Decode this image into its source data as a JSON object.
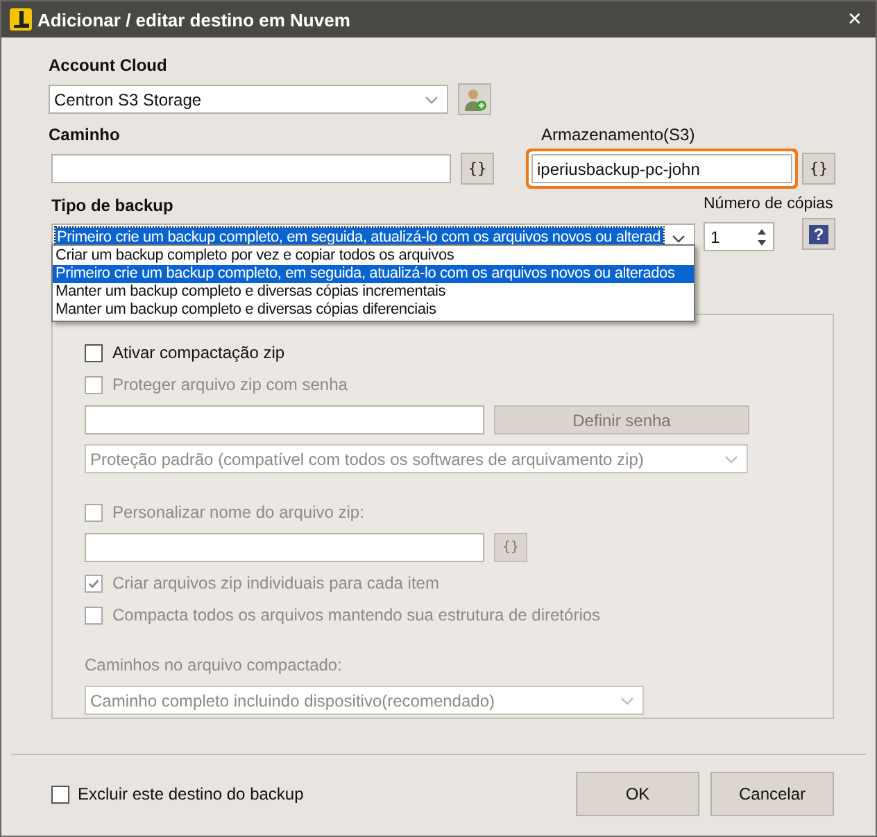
{
  "window": {
    "title": "Adicionar / editar destino em Nuvem",
    "close": "✕"
  },
  "account_cloud": {
    "label": "Account Cloud",
    "value": "Centron S3 Storage"
  },
  "path": {
    "label": "Caminho",
    "variable_button": "{}"
  },
  "storage": {
    "label": "Armazenamento(S3)",
    "value": "iperiusbackup-pc-john",
    "highlighted": true,
    "variable_button": "{}"
  },
  "backup_type": {
    "label": "Tipo de backup",
    "value": "Primeiro crie um backup completo, em seguida, atualizá-lo com os arquivos novos ou alterad",
    "expanded": true,
    "options": [
      {
        "label": "Criar um backup completo por vez e copiar todos os arquivos",
        "selected": false
      },
      {
        "label": "Primeiro crie um backup completo, em seguida, atualizá-lo com os arquivos novos ou alterados",
        "selected": true
      },
      {
        "label": "Manter um backup completo e diversas cópias incrementais",
        "selected": false
      },
      {
        "label": "Manter um backup completo e diversas cópias diferenciais",
        "selected": false
      }
    ]
  },
  "copies": {
    "label": "Número de cópias",
    "value": "1",
    "help": "?"
  },
  "zip": {
    "items": [
      {
        "kind": "checkbox",
        "label": "Ativar compactação zip",
        "checked": false,
        "disabled": false
      },
      {
        "kind": "checkbox",
        "label": "Proteger arquivo zip com senha",
        "checked": false,
        "disabled": true
      },
      {
        "kind": "fieldaction",
        "button": "Definir senha",
        "disabled": true
      },
      {
        "kind": "select",
        "value": "Proteção padrão (compatível com todos os softwares de arquivamento zip)",
        "disabled": true,
        "wide": true
      },
      {
        "kind": "checkbox",
        "label": "Personalizar nome do arquivo zip:",
        "checked": false,
        "disabled": true,
        "spaced": true
      },
      {
        "kind": "fieldvariable",
        "button": "{}",
        "disabled": true
      },
      {
        "kind": "checkbox",
        "label": "Criar arquivos zip individuais para cada item",
        "checked": true,
        "disabled": true
      },
      {
        "kind": "checkbox",
        "label": "Compacta todos os arquivos mantendo sua estrutura de diretórios",
        "checked": false,
        "disabled": true
      },
      {
        "kind": "label",
        "label": "Caminhos no arquivo compactado:",
        "disabled": true,
        "spaced": true
      },
      {
        "kind": "select",
        "value": "Caminho completo incluindo dispositivo(recomendado)",
        "disabled": true,
        "wide": false
      }
    ]
  },
  "footer": {
    "exclude": {
      "label": "Excluir este destino do backup",
      "checked": false
    },
    "buttons": [
      "OK",
      "Cancelar"
    ]
  }
}
